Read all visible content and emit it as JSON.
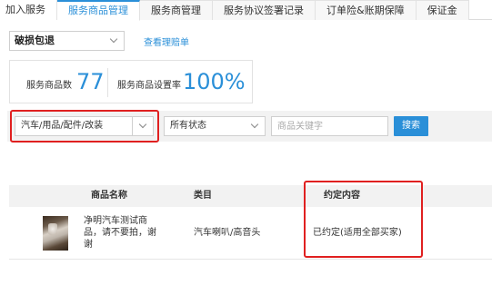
{
  "tabs": [
    {
      "label": "加入服务",
      "active": false
    },
    {
      "label": "服务商品管理",
      "active": true
    },
    {
      "label": "服务商管理",
      "active": false
    },
    {
      "label": "服务协议签署记录",
      "active": false
    },
    {
      "label": "订单险&账期保障",
      "active": false
    },
    {
      "label": "保证金",
      "active": false
    }
  ],
  "service_select": {
    "value": "破损包退"
  },
  "claim_link": "查看理赔单",
  "stats": {
    "count_label": "服务商品数",
    "count_value": "77",
    "rate_label": "服务商品设置率",
    "rate_value": "100%"
  },
  "filters": {
    "category_select": "汽车/用品/配件/改装",
    "status_select": "所有状态",
    "keyword_placeholder": "商品关键字",
    "search_button": "搜索"
  },
  "table": {
    "columns": [
      "商品名称",
      "类目",
      "约定内容"
    ],
    "rows": [
      {
        "name_line1": "净明汽车测试商",
        "name_line2": "品，请不要拍，谢",
        "name_line3": "谢",
        "category": "汽车喇叭/高音头",
        "agreement": "已约定(适用全部买家)"
      }
    ]
  },
  "colors": {
    "accent": "#2a8fd8",
    "highlight": "#e02020"
  }
}
